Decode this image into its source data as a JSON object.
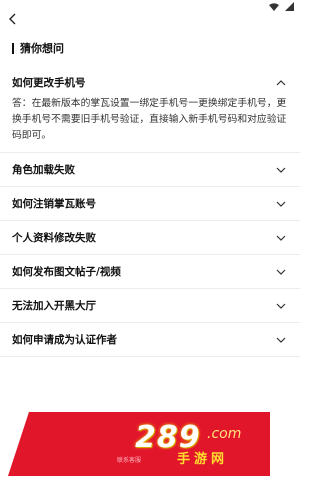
{
  "nav": {
    "back_icon": "back-arrow-icon"
  },
  "status_icons": [
    "wifi-icon",
    "signal-icon"
  ],
  "section": {
    "title": "猜你想问"
  },
  "faq": [
    {
      "question": "如何更改手机号",
      "expanded": true,
      "answer": "答：在最新版本的掌瓦设置一绑定手机号一更换绑定手机号，更换手机号不需要旧手机号验证，直接输入新手机号码和对应验证码即可。"
    },
    {
      "question": "角色加载失败",
      "expanded": false
    },
    {
      "question": "如何注销掌瓦账号",
      "expanded": false
    },
    {
      "question": "个人资料修改失败",
      "expanded": false
    },
    {
      "question": "如何发布图文帖子/视频",
      "expanded": false
    },
    {
      "question": "无法加入开黑大厅",
      "expanded": false
    },
    {
      "question": "如何申请成为认证作者",
      "expanded": false
    }
  ],
  "banner": {
    "label": "联系客服",
    "color": "#e2162b"
  },
  "watermark": {
    "num": "289",
    "com": ".com",
    "sub": "手游网"
  }
}
